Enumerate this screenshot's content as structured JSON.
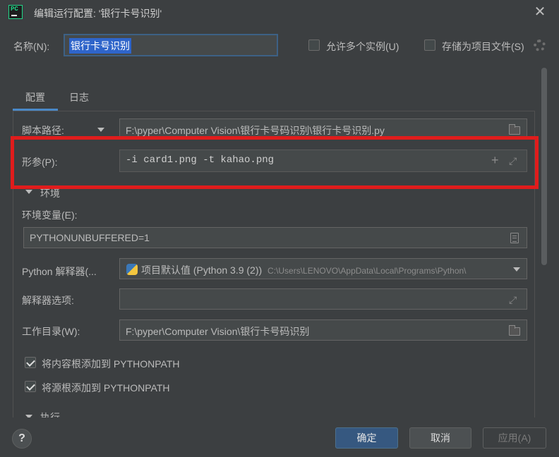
{
  "window": {
    "title": "编辑运行配置: '银行卡号识别'",
    "app_icon_text": "PC"
  },
  "header": {
    "name_label": "名称(N):",
    "name_value": "银行卡号识别",
    "allow_parallel_label": "允许多个实例(U)",
    "allow_parallel_checked": false,
    "store_as_file_label": "存储为项目文件(S)",
    "store_as_file_checked": false
  },
  "tabs": [
    {
      "label": "配置",
      "active": true
    },
    {
      "label": "日志",
      "active": false
    }
  ],
  "config": {
    "script_path_label": "脚本路径:",
    "script_path_value": "F:\\pyper\\Computer Vision\\银行卡号码识别\\银行卡号识别.py",
    "params_label": "形参(P):",
    "params_value": "-i card1.png -t kahao.png",
    "env_section_label": "环境",
    "env_vars_label": "环境变量(E):",
    "env_vars_value": "PYTHONUNBUFFERED=1",
    "interpreter_label": "Python 解释器(...",
    "interpreter_value": "项目默认值 (Python 3.9 (2))",
    "interpreter_path": "C:\\Users\\LENOVO\\AppData\\Local\\Programs\\Python\\",
    "interpreter_options_label": "解释器选项:",
    "interpreter_options_value": "",
    "working_dir_label": "工作目录(W):",
    "working_dir_value": "F:\\pyper\\Computer Vision\\银行卡号码识别",
    "add_content_roots_label": "将内容根添加到 PYTHONPATH",
    "add_content_roots_checked": true,
    "add_source_roots_label": "将源根添加到 PYTHONPATH",
    "add_source_roots_checked": true,
    "exec_section_label": "执行"
  },
  "footer": {
    "help_label": "?",
    "ok_label": "确定",
    "cancel_label": "取消",
    "apply_label": "应用(A)"
  },
  "colors": {
    "background": "#3c3f41",
    "field_bg": "#45494a",
    "accent": "#4a88c7",
    "highlight_box": "#e01c1c",
    "primary_button": "#365880"
  }
}
